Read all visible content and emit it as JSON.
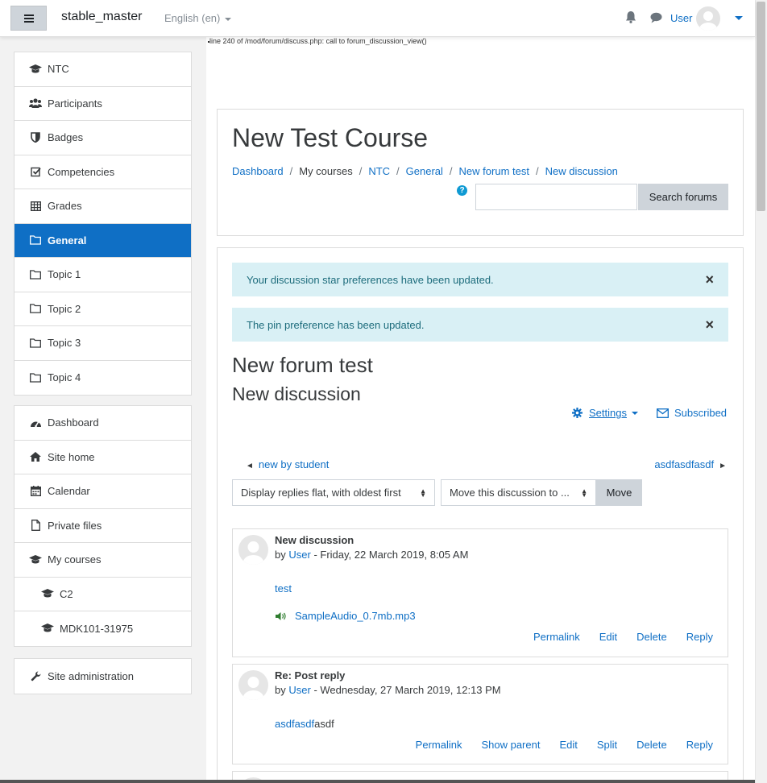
{
  "navbar": {
    "site_name": "stable_master",
    "language": "English (en)",
    "user_name": "User"
  },
  "debug_line": "line 240 of /mod/forum/discuss.php: call to forum_discussion_view()",
  "nav_blocks": {
    "course": [
      {
        "label": "NTC",
        "icon": "graduation-cap-icon"
      },
      {
        "label": "Participants",
        "icon": "users-icon"
      },
      {
        "label": "Badges",
        "icon": "shield-icon"
      },
      {
        "label": "Competencies",
        "icon": "checkbox-icon"
      },
      {
        "label": "Grades",
        "icon": "table-icon"
      },
      {
        "label": "General",
        "icon": "folder-icon",
        "active": true
      },
      {
        "label": "Topic 1",
        "icon": "folder-icon"
      },
      {
        "label": "Topic 2",
        "icon": "folder-icon"
      },
      {
        "label": "Topic 3",
        "icon": "folder-icon"
      },
      {
        "label": "Topic 4",
        "icon": "folder-icon"
      }
    ],
    "site": [
      {
        "label": "Dashboard",
        "icon": "tachometer-icon"
      },
      {
        "label": "Site home",
        "icon": "home-icon"
      },
      {
        "label": "Calendar",
        "icon": "calendar-icon"
      },
      {
        "label": "Private files",
        "icon": "file-icon"
      },
      {
        "label": "My courses",
        "icon": "graduation-cap-icon"
      },
      {
        "label": "C2",
        "icon": "graduation-cap-icon"
      },
      {
        "label": "MDK101-31975",
        "icon": "graduation-cap-icon"
      }
    ],
    "admin": [
      {
        "label": "Site administration",
        "icon": "wrench-icon"
      }
    ]
  },
  "header": {
    "course_title": "New Test Course",
    "breadcrumbs": [
      "Dashboard",
      "My courses",
      "NTC",
      "General",
      "New forum test",
      "New discussion"
    ],
    "search_placeholder": "",
    "search_button": "Search forums"
  },
  "alerts": [
    "Your discussion star preferences have been updated.",
    "The pin preference has been updated."
  ],
  "forum": {
    "forum_title": "New forum test",
    "discussion_title": "New discussion",
    "settings_label": "Settings",
    "subscribed_label": "Subscribed",
    "prev_discussion": "new by student",
    "next_discussion": "asdfasdfasdf",
    "display_mode": "Display replies flat, with oldest first",
    "move_select": "Move this discussion to ...",
    "move_button": "Move"
  },
  "posts": [
    {
      "subject": "New discussion",
      "by": "by",
      "author": "User",
      "date": "- Friday, 22 March 2019, 8:05 AM",
      "message": "test",
      "attachment": "SampleAudio_0.7mb.mp3",
      "commands": [
        "Permalink",
        "Edit",
        "Delete",
        "Reply"
      ]
    },
    {
      "subject": "Re: Post reply",
      "by": "by",
      "author": "User",
      "date": "- Wednesday, 27 March 2019, 12:13 PM",
      "message_link": "asdfasdf",
      "message_rest": "asdf",
      "commands": [
        "Permalink",
        "Show parent",
        "Edit",
        "Split",
        "Delete",
        "Reply"
      ]
    }
  ],
  "colors": {
    "accent": "#0f6fc5",
    "alert_bg": "#d9f0f5",
    "alert_text": "#1d6c7c"
  }
}
